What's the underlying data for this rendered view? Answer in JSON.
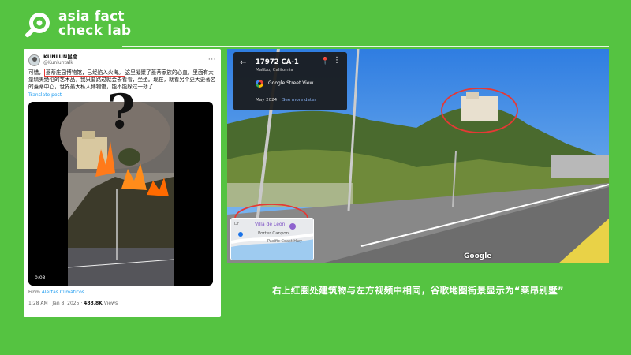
{
  "brand": {
    "line1": "asia fact",
    "line2": "check lab"
  },
  "tweet": {
    "name": "KUNLUN昆侖",
    "handle": "@Kunluntalk",
    "more": "···",
    "text_pre": "可惜，",
    "text_highlight": "蓋蒂庄园博物馆，已经陷入火海。",
    "text_post": "这里凝聚了蓋蒂家族的心血。里面有大量精美绝伦的艺术品，我只要路过就会去看看，坐坐。现在，就看另个更大更著名的蓋蒂中心，世界最大私人博物馆，能不能躲过一劫了…",
    "translate": "Translate post",
    "video_time": "0:03",
    "from_label": "From ",
    "from_source": "Alertas Climáticos",
    "meta_time": "1:28 AM · Jan 8, 2025 · ",
    "meta_views": "488.8K",
    "meta_views_label": " Views"
  },
  "question_mark": "?",
  "streetview": {
    "back": "←",
    "title": "17972 CA-1",
    "subtitle": "Malibu, California",
    "product": "Google Street View",
    "date": "May 2024",
    "see_more": "See more dates",
    "map_label_1": "Villa de Leon",
    "map_label_2": "Porter Canyon",
    "map_label_3": "Pacific Coast Hwy",
    "map_label_4": "Dr",
    "watermark": "Google"
  },
  "caption": "右上红圈处建筑物与左方视频中相同，谷歌地图街景显示为“莱昂别墅”"
}
